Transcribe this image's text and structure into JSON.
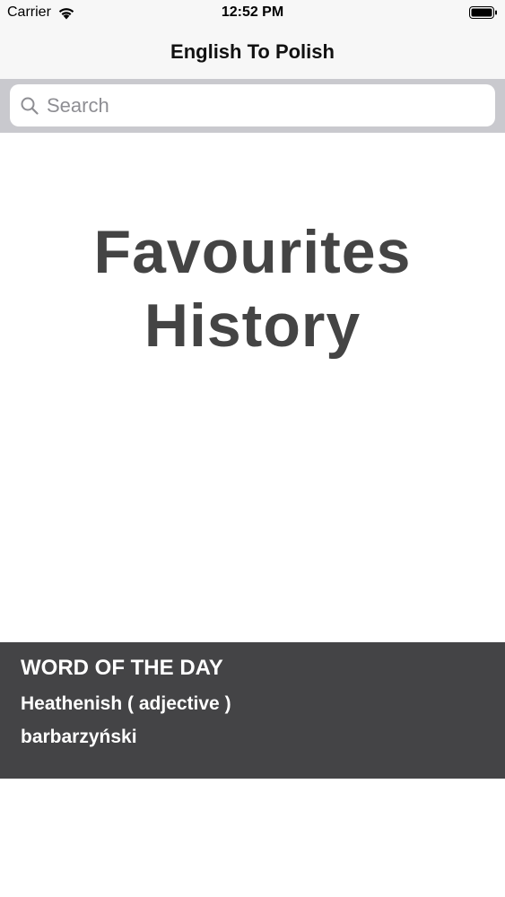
{
  "status_bar": {
    "carrier": "Carrier",
    "time": "12:52 PM",
    "wifi_icon": "wifi-icon",
    "battery_icon": "battery-icon"
  },
  "nav": {
    "title": "English To Polish"
  },
  "search": {
    "placeholder": "Search",
    "value": "",
    "icon": "magnifier-icon"
  },
  "menu": {
    "favourites": "Favourites",
    "history": "History"
  },
  "word_of_the_day": {
    "heading": "WORD OF THE DAY",
    "word": "Heathenish ( adjective )",
    "translation": "barbarzyński"
  },
  "colors": {
    "accent_dark": "#444446",
    "menu_text": "#444444",
    "search_bar_bg": "#c9c9ce"
  }
}
